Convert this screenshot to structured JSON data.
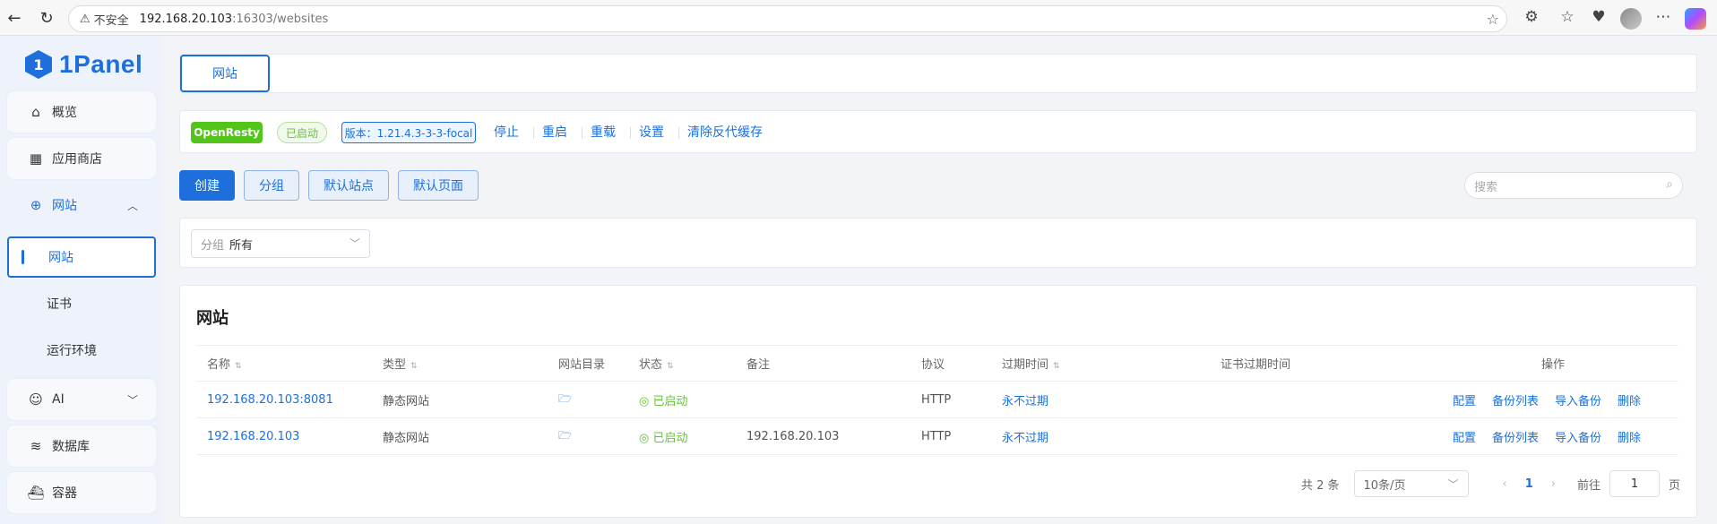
{
  "browser": {
    "security": "不安全",
    "url_host": "192.168.20.103",
    "url_path": ":16303/websites"
  },
  "logo": {
    "text": "1Panel"
  },
  "sidebar": {
    "items": [
      {
        "label": "概览"
      },
      {
        "label": "应用商店"
      },
      {
        "label": "网站"
      },
      {
        "label": "AI"
      },
      {
        "label": "数据库"
      },
      {
        "label": "容器"
      }
    ],
    "sub_items": [
      {
        "label": "网站"
      },
      {
        "label": "证书"
      },
      {
        "label": "运行环境"
      }
    ]
  },
  "tabs": [
    {
      "label": "网站"
    }
  ],
  "status_bar": {
    "app_tag": "OpenResty",
    "status_tag": "已启动",
    "version_tag": "版本：1.21.4.3-3-3-focal",
    "actions": [
      "停止",
      "重启",
      "重载",
      "设置",
      "清除反代缓存"
    ]
  },
  "toolbar": {
    "buttons": [
      "创建",
      "分组",
      "默认站点",
      "默认页面"
    ],
    "search_placeholder": "搜索"
  },
  "filter": {
    "prefix": "分组",
    "value": "所有"
  },
  "table": {
    "title": "网站",
    "columns": [
      "名称",
      "类型",
      "网站目录",
      "状态",
      "备注",
      "协议",
      "过期时间",
      "证书过期时间",
      "操作"
    ],
    "rows": [
      {
        "name": "192.168.20.103:8081",
        "type": "静态网站",
        "status": "已启动",
        "remark": "",
        "protocol": "HTTP",
        "expire": "永不过期",
        "cert_expire": ""
      },
      {
        "name": "192.168.20.103",
        "type": "静态网站",
        "status": "已启动",
        "remark": "192.168.20.103",
        "protocol": "HTTP",
        "expire": "永不过期",
        "cert_expire": ""
      }
    ],
    "row_ops": [
      "配置",
      "备份列表",
      "导入备份",
      "删除"
    ]
  },
  "pagination": {
    "total": "共 2 条",
    "page_size": "10条/页",
    "current": "1",
    "goto_label": "前往",
    "goto_value": "1",
    "page_unit": "页"
  },
  "colors": {
    "primary": "#1e6fdc",
    "success": "#67c23a",
    "openresty": "#52c41a"
  }
}
